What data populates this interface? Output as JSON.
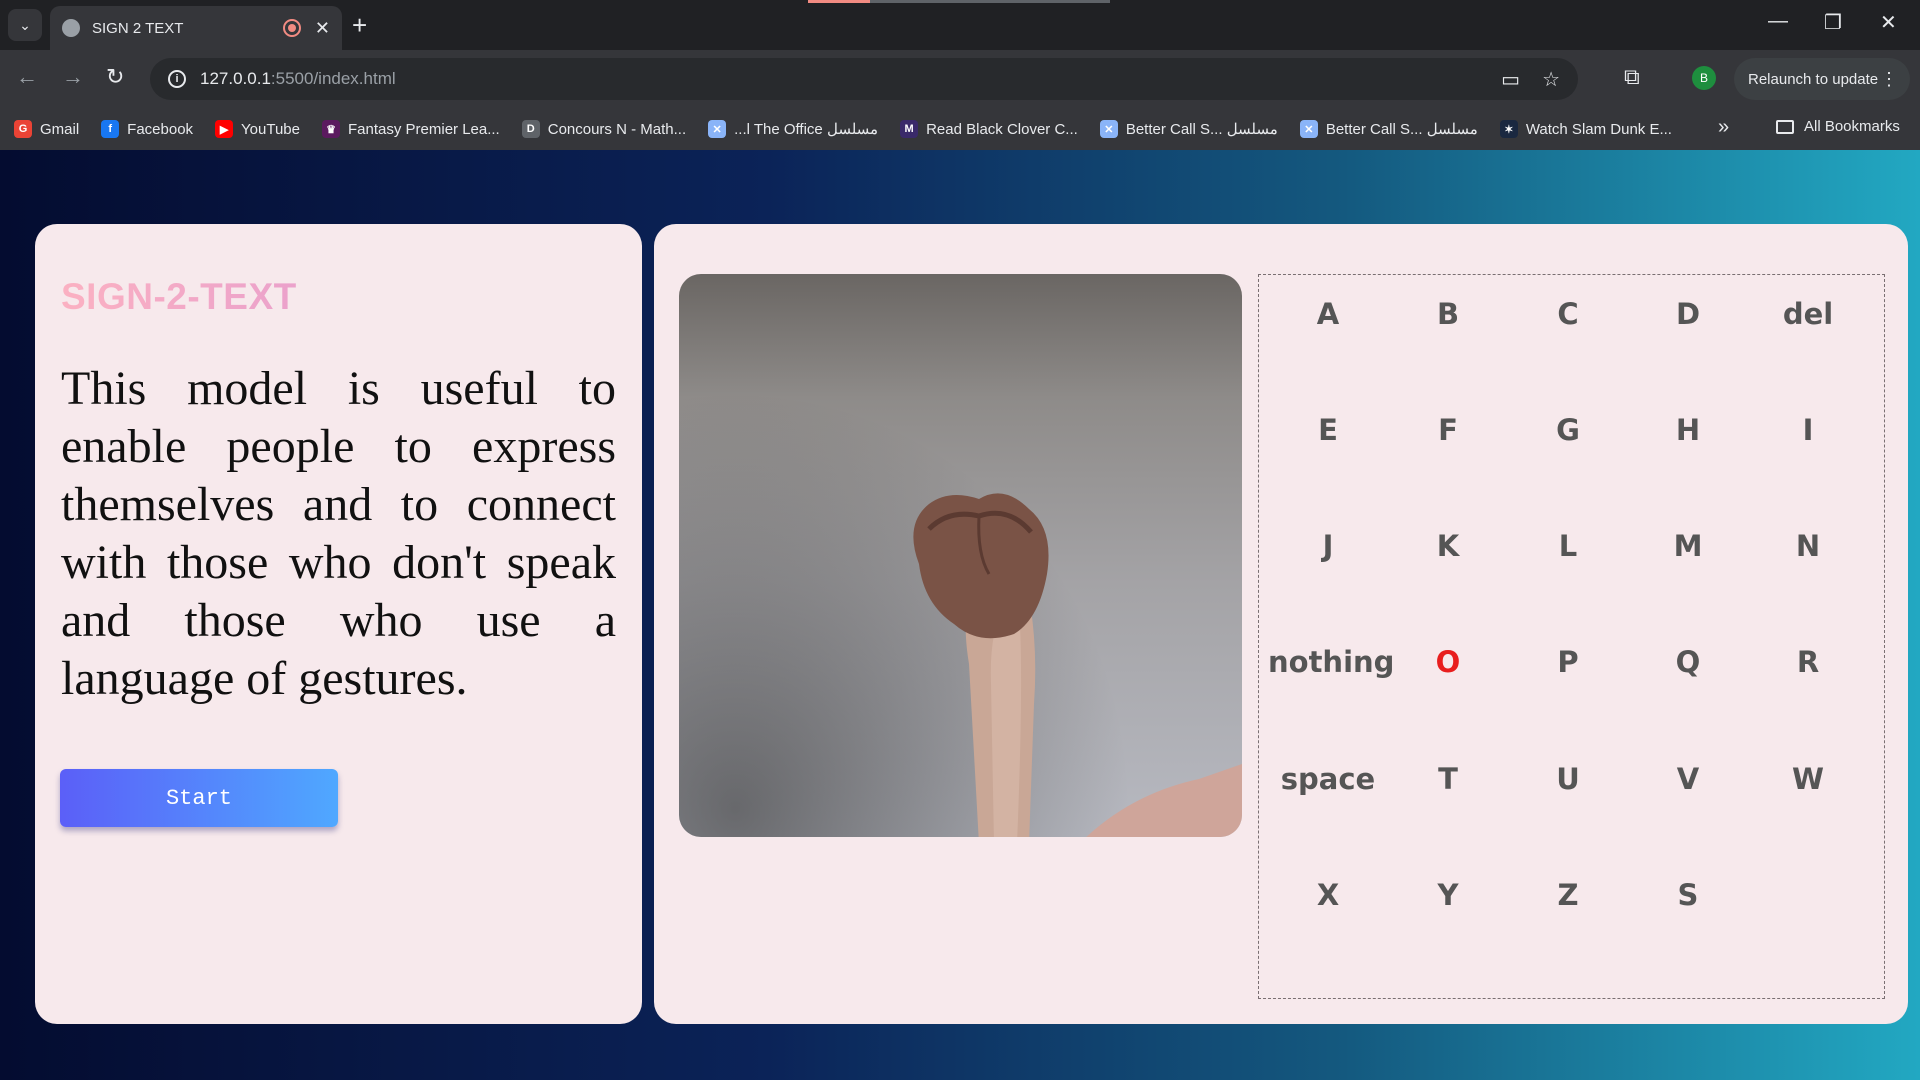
{
  "browser": {
    "tab_title": "SIGN 2 TEXT",
    "url_host": "127.0.0.1",
    "url_path": ":5500/index.html",
    "relaunch_label": "Relaunch to update",
    "profile_initial": "B",
    "all_bookmarks_label": "All Bookmarks",
    "bookmarks": [
      {
        "label": "Gmail",
        "icon": "gmail-icon",
        "color": "#ea4335",
        "glyph": "G"
      },
      {
        "label": "Facebook",
        "icon": "facebook-icon",
        "color": "#1877f2",
        "glyph": "f"
      },
      {
        "label": "YouTube",
        "icon": "youtube-icon",
        "color": "#ff0000",
        "glyph": "▶"
      },
      {
        "label": "Fantasy Premier Lea...",
        "icon": "premier-league-icon",
        "color": "#5b1a5f",
        "glyph": "♛"
      },
      {
        "label": "Concours N - Math...",
        "icon": "document-icon",
        "color": "#5f6368",
        "glyph": "D"
      },
      {
        "label": "...l The Office مسلسل",
        "icon": "site-icon",
        "color": "#8ab4f8",
        "glyph": "✕"
      },
      {
        "label": "Read Black Clover C...",
        "icon": "manga-icon",
        "color": "#3a2a6a",
        "glyph": "M"
      },
      {
        "label": "Better Call S... مسلسل",
        "icon": "site-icon",
        "color": "#8ab4f8",
        "glyph": "✕"
      },
      {
        "label": "Better Call S... مسلسل",
        "icon": "site-icon",
        "color": "#8ab4f8",
        "glyph": "✕"
      },
      {
        "label": "Watch Slam Dunk E...",
        "icon": "anime-icon",
        "color": "#1a2840",
        "glyph": "✶"
      }
    ]
  },
  "app": {
    "brand": "SIGN-2-TEXT",
    "description": "This model is useful to enable people to express themselves and to connect with those who don't speak and those who use a language of gestures.",
    "start_label": "Start",
    "active_letter": "O",
    "letters": [
      [
        "A",
        "B",
        "C",
        "D",
        "del"
      ],
      [
        "E",
        "F",
        "G",
        "H",
        "I"
      ],
      [
        "J",
        "K",
        "L",
        "M",
        "N"
      ],
      [
        "nothing",
        "O",
        "P",
        "Q",
        "R"
      ],
      [
        "space",
        "T",
        "U",
        "V",
        "W"
      ],
      [
        "X",
        "Y",
        "Z",
        "S"
      ]
    ],
    "colors": {
      "active_letter": "#e81e1e",
      "letter": "#555555",
      "card_bg": "#f7e9ec",
      "button_from": "#5b5ff8",
      "button_to": "#4fa8ff"
    }
  }
}
